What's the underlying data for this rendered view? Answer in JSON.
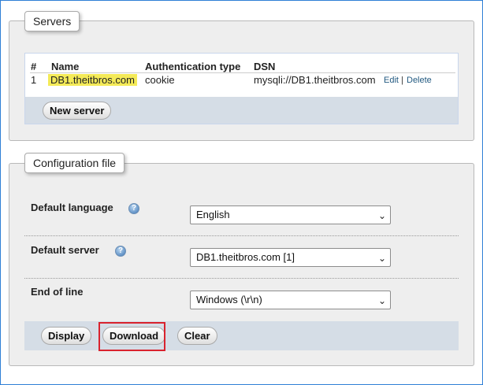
{
  "servers": {
    "legend": "Servers",
    "columns": {
      "num": "#",
      "name": "Name",
      "auth": "Authentication type",
      "dsn": "DSN"
    },
    "rows": [
      {
        "num": "1",
        "name": "DB1.theitbros.com",
        "auth": "cookie",
        "dsn": "mysqli://DB1.theitbros.com",
        "edit": "Edit",
        "sep": "|",
        "delete": "Delete"
      }
    ],
    "new_server_label": "New server"
  },
  "config": {
    "legend": "Configuration file",
    "default_language": {
      "label": "Default language",
      "value": "English",
      "help_icon": "help-icon"
    },
    "default_server": {
      "label": "Default server",
      "value": "DB1.theitbros.com [1]",
      "help_icon": "help-icon"
    },
    "end_of_line": {
      "label": "End of line",
      "value": "Windows (\\r\\n)"
    },
    "buttons": {
      "display": "Display",
      "download": "Download",
      "clear": "Clear"
    }
  },
  "colors": {
    "highlight": "#f4ea58",
    "annotation_box": "#d9232e",
    "footer_bar": "#d5dde6",
    "window_border": "#2f7fd6"
  }
}
